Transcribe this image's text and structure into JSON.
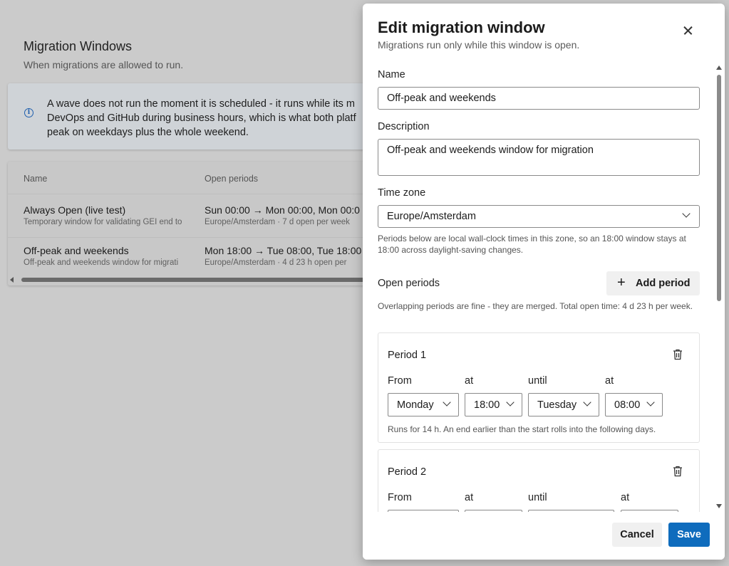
{
  "background": {
    "title": "Migration Windows",
    "subtitle": "When migrations are allowed to run.",
    "info_lines": [
      "A wave does not run the moment it is scheduled - it runs while its m",
      "DevOps and GitHub during business hours, which is what both platf",
      "peak on weekdays plus the whole weekend."
    ],
    "table": {
      "headers": [
        "Name",
        "Open periods"
      ],
      "rows": [
        {
          "name": "Always Open (live test)",
          "description": "Temporary window for validating GEI end to",
          "periods": "Sun 00:00 → Mon 00:00, Mon 00:0",
          "periods_sub": "Europe/Amsterdam · 7 d open per week"
        },
        {
          "name": "Off-peak and weekends",
          "description": "Off-peak and weekends window for migrati",
          "periods": "Mon 18:00 → Tue 08:00, Tue 18:00",
          "periods_sub": "Europe/Amsterdam · 4 d 23 h open per"
        }
      ]
    }
  },
  "panel": {
    "title": "Edit migration window",
    "subtitle": "Migrations run only while this window is open.",
    "name_label": "Name",
    "name_value": "Off-peak and weekends",
    "description_label": "Description",
    "description_value": "Off-peak and weekends window for migration",
    "timezone_label": "Time zone",
    "timezone_value": "Europe/Amsterdam",
    "timezone_help": "Periods below are local wall-clock times in this zone, so an 18:00 window stays at 18:00 across daylight-saving changes.",
    "open_periods_label": "Open periods",
    "add_period_label": "Add period",
    "open_periods_help": "Overlapping periods are fine - they are merged. Total open time: 4 d 23 h per week.",
    "periods": [
      {
        "title": "Period 1",
        "from_label": "From",
        "at_label": "at",
        "until_label": "until",
        "at2_label": "at",
        "from_day": "Monday",
        "from_time": "18:00",
        "until_day": "Tuesday",
        "until_time": "08:00",
        "help": "Runs for 14 h. An end earlier than the start rolls into the following days."
      },
      {
        "title": "Period 2",
        "from_label": "From",
        "at_label": "at",
        "until_label": "until",
        "at2_label": "at"
      }
    ],
    "cancel_label": "Cancel",
    "save_label": "Save"
  },
  "colors": {
    "primary": "#0f6cbd",
    "overlay": "#cbcbcb",
    "info_icon": "#1f5fae"
  },
  "icons": [
    "info-icon",
    "close-icon",
    "plus-icon",
    "trash-icon",
    "chevron-down-icon"
  ]
}
